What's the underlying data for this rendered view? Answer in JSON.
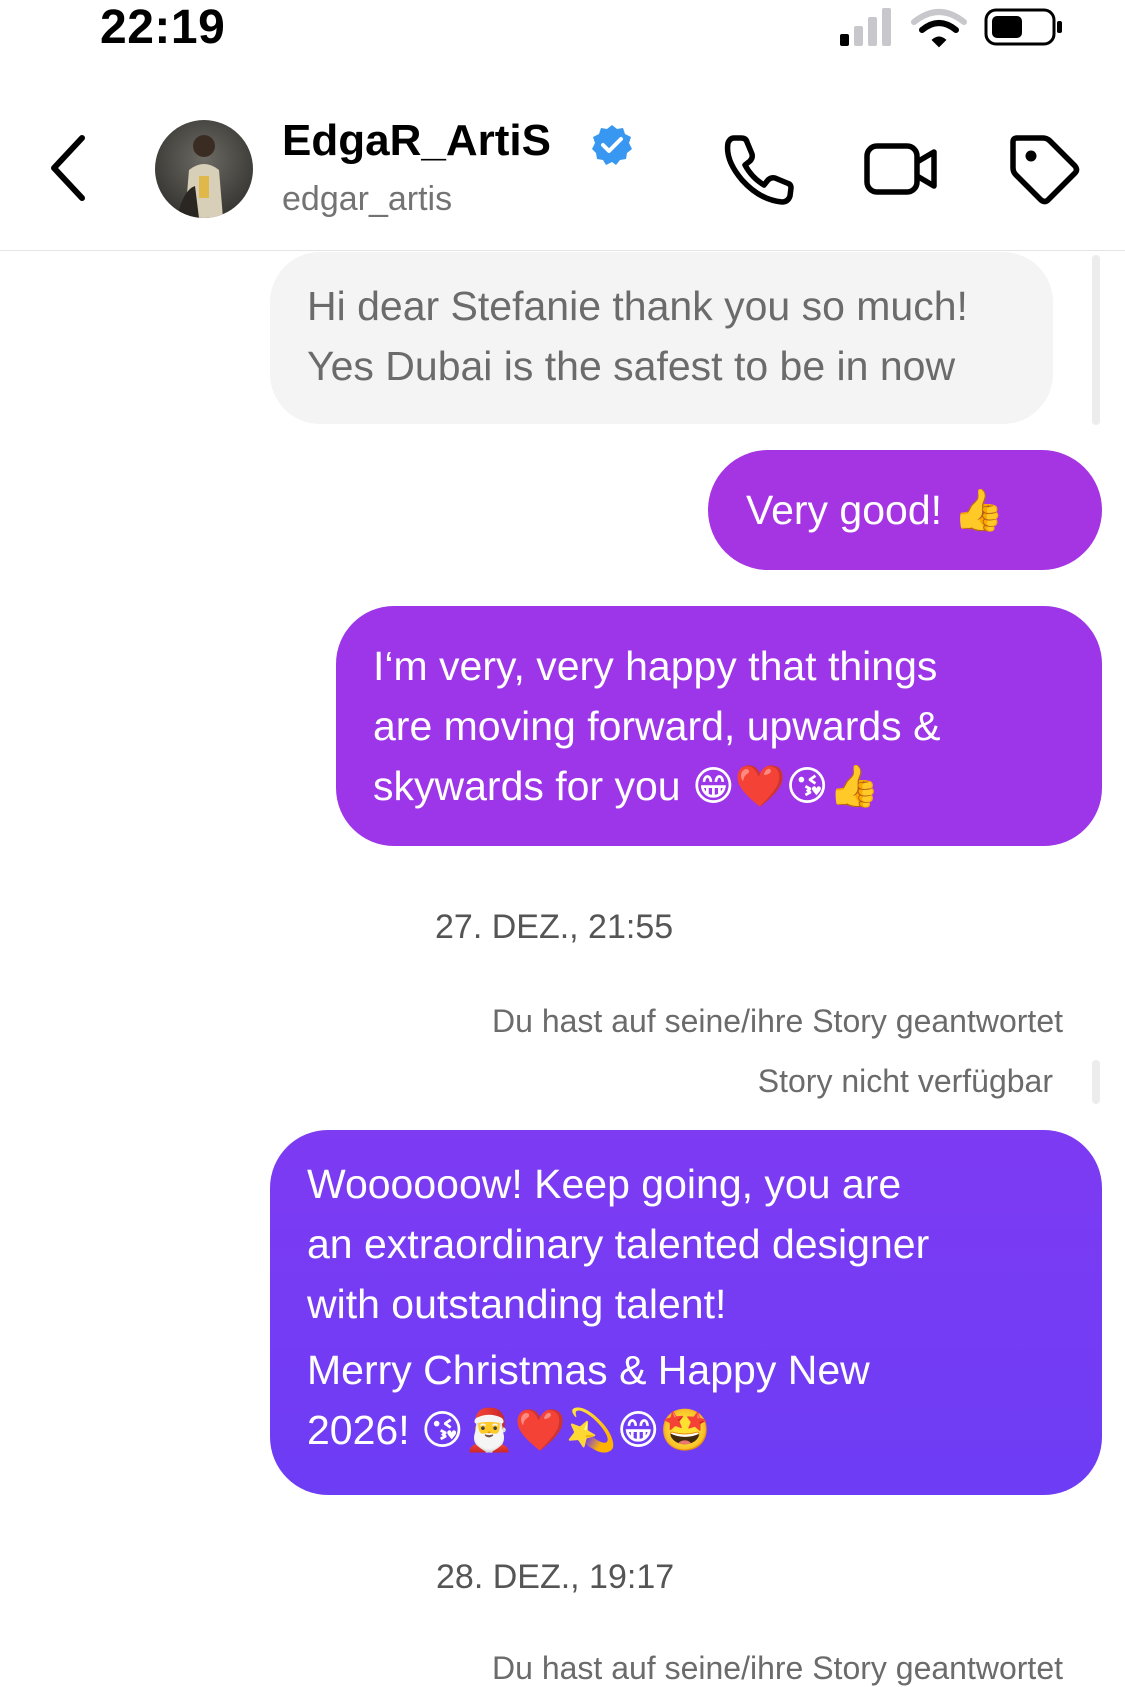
{
  "status_bar": {
    "time": "22:19"
  },
  "header": {
    "display_name": "EdgaR_ArtiS",
    "username": "edgar_artis",
    "verified": true
  },
  "messages": [
    {
      "direction": "incoming",
      "lines": [
        "Hi dear Stefanie thank you so much!",
        "Yes Dubai is the safest to be in now"
      ]
    },
    {
      "direction": "outgoing",
      "lines": [
        "Very good! 👍"
      ]
    },
    {
      "direction": "outgoing",
      "lines": [
        "I‘m very, very happy that things",
        "are moving forward, upwards &",
        "skywards for you 😁❤️😘👍"
      ]
    },
    {
      "direction": "outgoing",
      "lines": [
        "Woooooow! Keep going, you are",
        "an extraordinary talented designer",
        "with outstanding talent!",
        "Merry Christmas & Happy New",
        "2026! 😘🎅❤️💫😁🤩"
      ]
    }
  ],
  "separators": {
    "date_1": "27. DEZ., 21:55",
    "story_reply_1": "Du hast auf seine/ihre Story geantwortet",
    "story_unavailable": "Story nicht verfügbar",
    "date_2": "28. DEZ., 19:17",
    "story_reply_2": "Du hast auf seine/ihre Story geantwortet"
  },
  "colors": {
    "outgoing_purple": "#a534e3",
    "outgoing_violet": "#7d3bf2",
    "incoming_bg": "#f4f4f5",
    "verified_blue": "#3897f0"
  },
  "icons": [
    "back-chevron-icon",
    "verified-badge-icon",
    "phone-icon",
    "video-camera-icon",
    "tag-icon",
    "cellular-signal-icon",
    "wifi-icon",
    "battery-icon"
  ]
}
